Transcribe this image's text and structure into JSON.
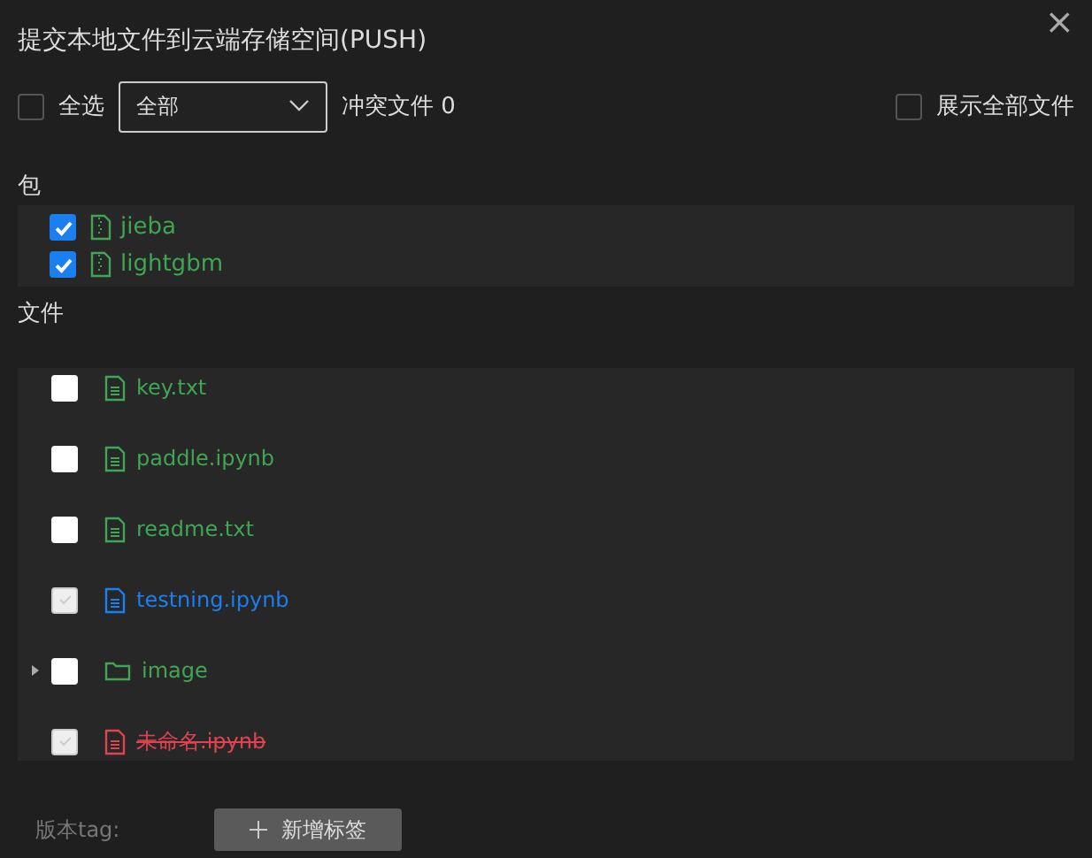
{
  "dialog": {
    "title": "提交本地文件到云端存储空间(PUSH)",
    "close": "×"
  },
  "toolbar": {
    "select_all": {
      "label": "全选",
      "checked": false
    },
    "filter": {
      "value": "全部"
    },
    "conflicts": "冲突文件 0",
    "show_all": {
      "label": "展示全部文件",
      "checked": false
    }
  },
  "packages": {
    "heading": "包",
    "items": [
      {
        "name": "jieba",
        "checked": true
      },
      {
        "name": "lightgbm",
        "checked": true
      }
    ]
  },
  "files": {
    "heading": "文件",
    "items": [
      {
        "name": "key.txt",
        "kind": "file",
        "color": "#3fa653",
        "struck": false,
        "checked": false,
        "disabled": false
      },
      {
        "name": "paddle.ipynb",
        "kind": "file",
        "color": "#3fa653",
        "struck": false,
        "checked": false,
        "disabled": false
      },
      {
        "name": "readme.txt",
        "kind": "file",
        "color": "#3fa653",
        "struck": false,
        "checked": false,
        "disabled": false
      },
      {
        "name": "testning.ipynb",
        "kind": "file",
        "color": "#1a7ff0",
        "struck": false,
        "checked": true,
        "disabled": true
      },
      {
        "name": "image",
        "kind": "folder",
        "color": "#3fa653",
        "struck": false,
        "checked": false,
        "disabled": false,
        "expanded": false
      },
      {
        "name": "未命名.ipynb",
        "kind": "file",
        "color": "#e0434f",
        "struck": true,
        "checked": true,
        "disabled": true
      }
    ]
  },
  "footer": {
    "label": "版本tag:",
    "add_tag_button": "新增标签"
  }
}
